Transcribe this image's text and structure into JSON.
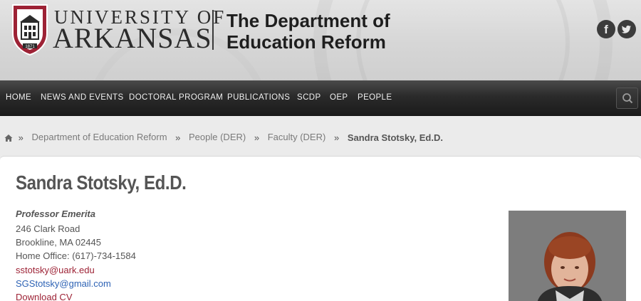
{
  "header": {
    "logo": {
      "line1": "UNIVERSITY OF",
      "line2": "ARKANSAS",
      "year": "1871"
    },
    "department": {
      "line1": "The Department of",
      "line2": "Education Reform"
    },
    "social": [
      {
        "icon": "facebook-icon",
        "glyph": "f"
      },
      {
        "icon": "twitter-icon",
        "glyph": "t"
      }
    ]
  },
  "nav": {
    "items": [
      "HOME",
      "NEWS AND EVENTS",
      "DOCTORAL PROGRAM",
      "PUBLICATIONS",
      "SCDP",
      "OEP",
      "PEOPLE"
    ],
    "search_icon": "search-icon"
  },
  "breadcrumb": {
    "home_icon": "home-icon",
    "separator": "»",
    "items": [
      "Department of Education Reform",
      "People (DER)",
      "Faculty (DER)"
    ],
    "current": "Sandra Stotsky, Ed.D."
  },
  "profile": {
    "name": "Sandra Stotsky, Ed.D.",
    "title": "Professor Emerita",
    "address1": "246 Clark Road",
    "address2": "Brookline, MA 02445",
    "phone": "Home Office: (617)-734-1584",
    "email1": "sstotsky@uark.edu",
    "email2": "SGStotsky@gmail.com",
    "cv_link": "Download CV"
  },
  "colors": {
    "brand_red": "#9d2235",
    "link_blue": "#2e63b5",
    "nav_bg": "#2b2b2b"
  }
}
